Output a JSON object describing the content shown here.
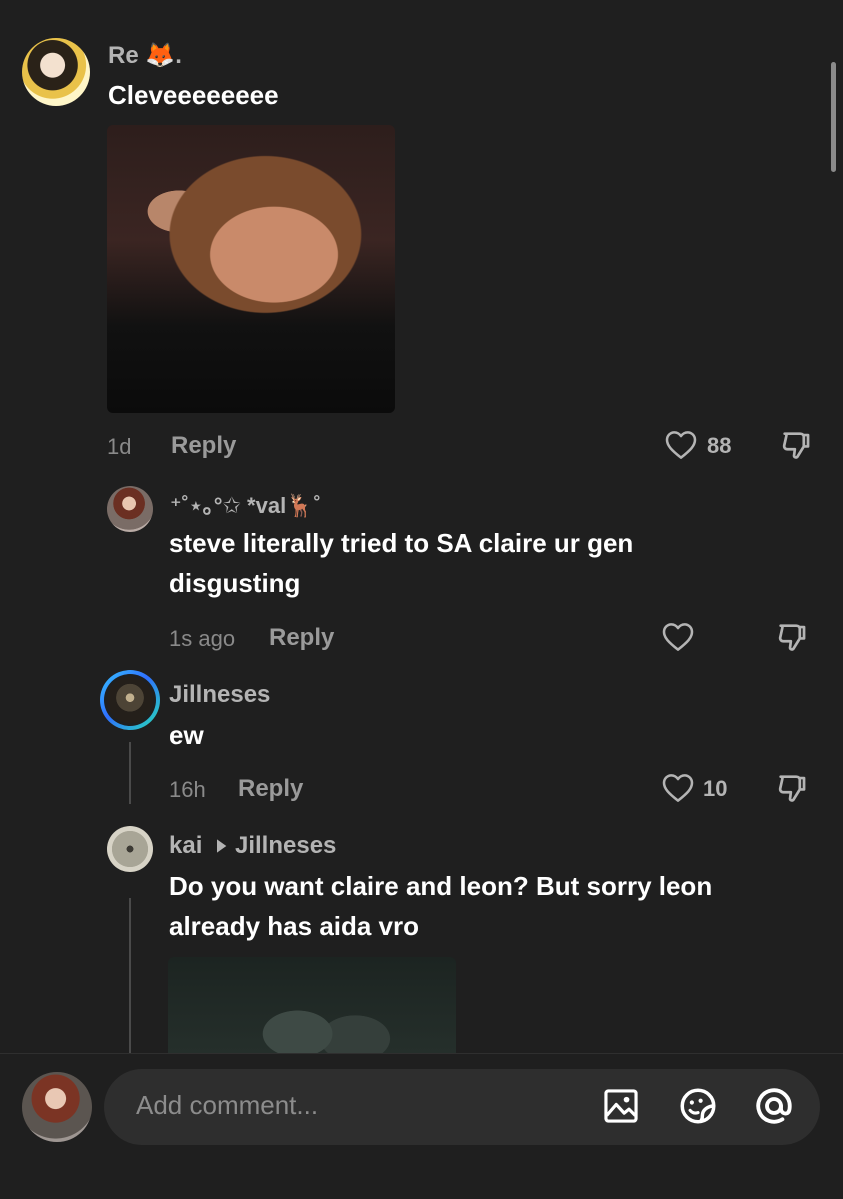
{
  "comments": [
    {
      "username": "Re 🦊.",
      "text": "Cleveeeeeeee",
      "time": "1d",
      "reply_label": "Reply",
      "likes": "88"
    },
    {
      "username": "⁺˚⋆｡°✩ *val🦌˚",
      "text_line1": "steve literally tried to SA claire ur gen",
      "text_line2": "disgusting",
      "time": "1s ago",
      "reply_label": "Reply",
      "likes": ""
    },
    {
      "username": "Jillneses",
      "text": "ew",
      "time": "16h",
      "reply_label": "Reply",
      "likes": "10"
    },
    {
      "username": "kai",
      "reply_to": "Jillneses",
      "text_line1": "Do you want claire and leon? But sorry leon",
      "text_line2": "already has aida vro"
    }
  ],
  "composer": {
    "placeholder": "Add comment..."
  },
  "icons": {
    "like": "heart-icon",
    "dislike": "thumbs-down-icon",
    "image": "image-icon",
    "sticker": "sticker-icon",
    "mention": "at-icon",
    "reply_arrow": "caret-right-icon"
  }
}
